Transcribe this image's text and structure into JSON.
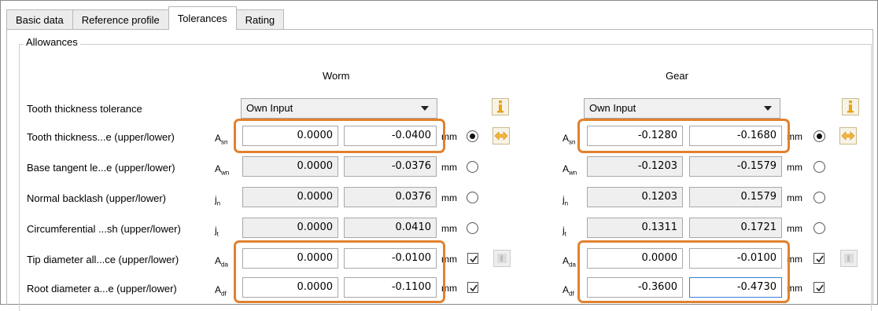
{
  "tabs": [
    {
      "label": "Basic data"
    },
    {
      "label": "Reference profile"
    },
    {
      "label": "Tolerances",
      "active": true
    },
    {
      "label": "Rating"
    }
  ],
  "group": {
    "title": "Allowances"
  },
  "columns": {
    "worm": "Worm",
    "gear": "Gear"
  },
  "tolerance_row": {
    "label": "Tooth thickness tolerance",
    "worm_select": "Own Input",
    "gear_select": "Own Input"
  },
  "rows": [
    {
      "label": "Tooth thickness...e (upper/lower)",
      "worm_sym": "A",
      "worm_sub": "sn",
      "gear_sym": "A",
      "gear_sub": "sn",
      "worm": [
        "0.0000",
        "-0.0400"
      ],
      "gear": [
        "-0.1280",
        "-0.1680"
      ],
      "unit": "mm",
      "control": "radio",
      "worm_on": true,
      "gear_on": true
    },
    {
      "label": "Base tangent le...e (upper/lower)",
      "worm_sym": "A",
      "worm_sub": "wn",
      "gear_sym": "A",
      "gear_sub": "wn",
      "worm": [
        "0.0000",
        "-0.0376"
      ],
      "gear": [
        "-0.1203",
        "-0.1579"
      ],
      "unit": "mm",
      "control": "radio"
    },
    {
      "label": "Normal backlash (upper/lower)",
      "worm_sym": "j",
      "worm_sub": "n",
      "gear_sym": "j",
      "gear_sub": "n",
      "worm": [
        "0.0000",
        "0.0376"
      ],
      "gear": [
        "0.1203",
        "0.1579"
      ],
      "unit": "mm",
      "control": "radio"
    },
    {
      "label": "Circumferential ...sh (upper/lower)",
      "worm_sym": "j",
      "worm_sub": "t",
      "gear_sym": "j",
      "gear_sub": "t",
      "worm": [
        "0.0000",
        "0.0410"
      ],
      "gear": [
        "0.1311",
        "0.1721"
      ],
      "unit": "mm",
      "control": "radio"
    },
    {
      "label": "Tip diameter all...ce (upper/lower)",
      "worm_sym": "A",
      "worm_sub": "da",
      "gear_sym": "A",
      "gear_sub": "da",
      "worm": [
        "0.0000",
        "-0.0100"
      ],
      "gear": [
        "0.0000",
        "-0.0100"
      ],
      "unit": "mm",
      "control": "check"
    },
    {
      "label": "Root diameter a...e (upper/lower)",
      "worm_sym": "A",
      "worm_sub": "df",
      "gear_sym": "A",
      "gear_sub": "df",
      "worm": [
        "0.0000",
        "-0.1100"
      ],
      "gear": [
        "-0.3600",
        "-0.4730"
      ],
      "unit": "mm",
      "control": "check"
    }
  ],
  "colors": {
    "highlight": "#e2812e",
    "info_icon": "#e8a317",
    "arrow_icon": "#f2b53a"
  }
}
